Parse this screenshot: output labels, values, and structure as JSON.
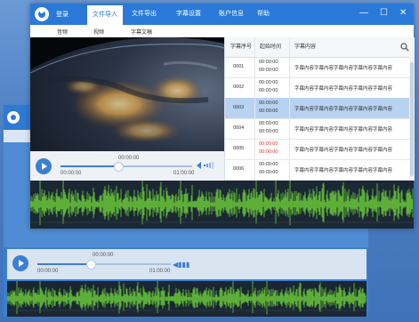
{
  "app": {
    "login_label": "登录",
    "tabs": [
      {
        "label": "文件导入",
        "active": true
      },
      {
        "label": "文件导出",
        "active": false
      },
      {
        "label": "字幕设置",
        "active": false
      },
      {
        "label": "账户信息",
        "active": false
      },
      {
        "label": "帮助",
        "active": false
      }
    ],
    "window_controls": {
      "minimize": "—",
      "maximize": "☐",
      "close": "✕"
    },
    "subtabs": [
      "音频",
      "视频",
      "字幕文稿"
    ]
  },
  "player": {
    "current_time": "00:00:00",
    "start_time": "00:00:00",
    "end_time": "01:00:00",
    "progress": 0.44
  },
  "table": {
    "headers": {
      "index": "字幕序号",
      "time": "起始时间",
      "content": "字幕内容"
    },
    "search_icon": "search-icon",
    "rows": [
      {
        "index": "0001",
        "start": "00:00:00",
        "end": "00:00:00",
        "content": "字幕内容字幕内容字幕内容字幕内容字幕内容",
        "selected": false,
        "red": false
      },
      {
        "index": "0002",
        "start": "00:00:00",
        "end": "00:00:00",
        "content": "字幕内容字幕内容字幕内容字幕内容字幕内容",
        "selected": false,
        "red": false
      },
      {
        "index": "0003",
        "start": "00:00:00",
        "end": "00:00:00",
        "content": "字幕内容字幕内容字幕内容字幕内容字幕内容",
        "selected": true,
        "red": false
      },
      {
        "index": "0004",
        "start": "00:00:00",
        "end": "00:00:00",
        "content": "字幕内容字幕内容字幕内容字幕内容字幕内容",
        "selected": false,
        "red": false
      },
      {
        "index": "0005",
        "start": "00:00:00",
        "end": "00:00:00",
        "content": "字幕内容字幕内容字幕内容字幕内容字幕内容",
        "selected": false,
        "red": true
      },
      {
        "index": "0006",
        "start": "00:00:00",
        "end": "00:00:00",
        "content": "字幕内容字幕内容字幕内容字幕内容字幕内容",
        "selected": false,
        "red": false
      }
    ]
  },
  "background_window": {
    "player": {
      "current_time": "00:00:00",
      "start_time": "00:00:00",
      "end_time": "01:00:00",
      "progress": 0.4
    }
  },
  "colors": {
    "accent": "#2a79d8",
    "selected_row": "#b8d3f2",
    "waveform": "#6fd13a",
    "alert": "#e03030"
  }
}
